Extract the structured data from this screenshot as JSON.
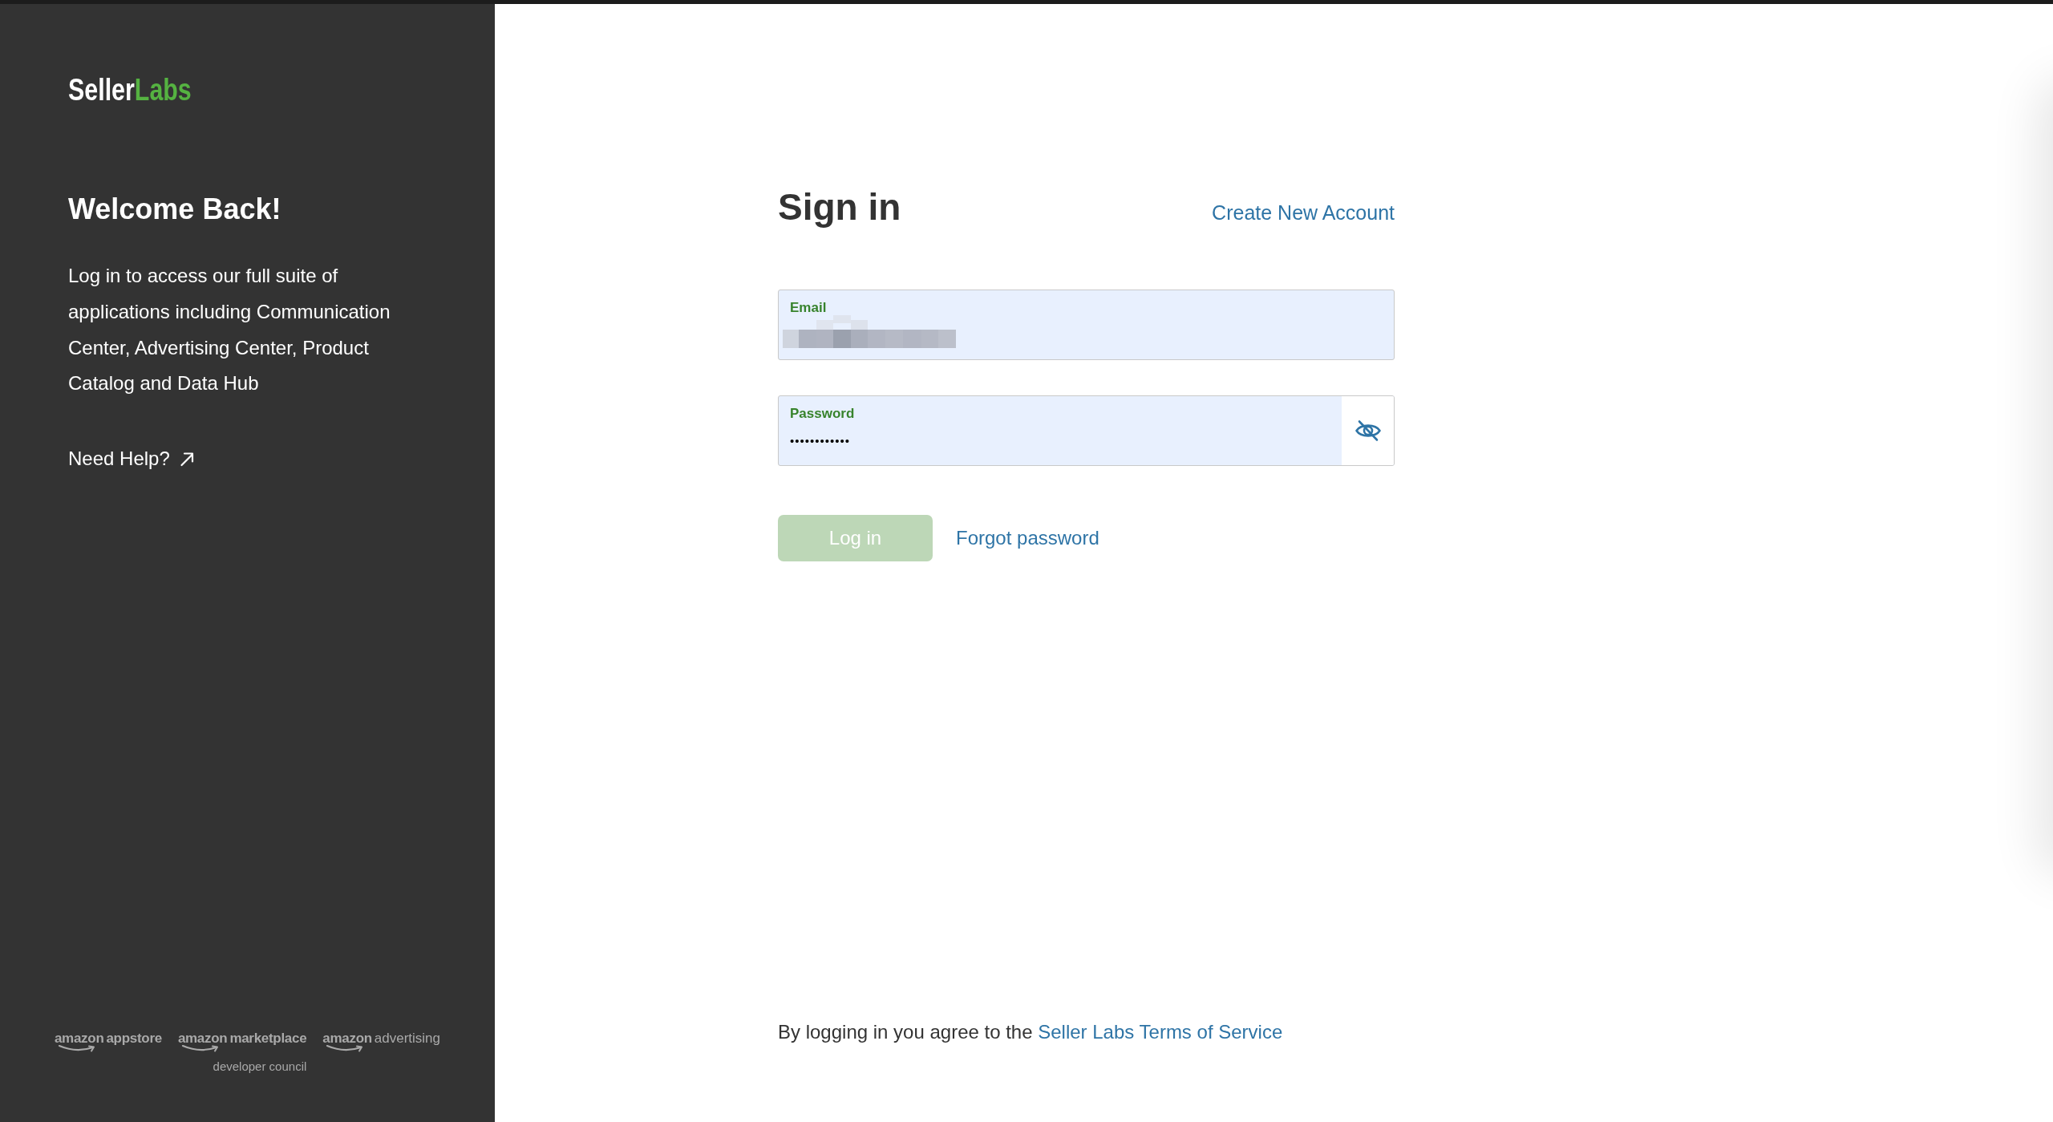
{
  "sidebar": {
    "logo": {
      "primary": "Seller",
      "accent": "Labs"
    },
    "heading": "Welcome Back!",
    "description": "Log in to access our full suite of applications including Communication Center, Advertising Center, Product Catalog and Data Hub",
    "help_link": "Need Help?",
    "partners": [
      {
        "brand": "amazon",
        "product": "appstore",
        "kind": "bold"
      },
      {
        "brand": "amazon",
        "product": "marketplace",
        "kind": "bold",
        "subtitle": "developer council"
      },
      {
        "brand": "amazon",
        "product": "advertising",
        "kind": "light"
      }
    ]
  },
  "form": {
    "title": "Sign in",
    "create_account_link": "Create New Account",
    "fields": [
      {
        "kind": "email",
        "label": "Email",
        "value_redacted": true,
        "autofilled": true
      },
      {
        "kind": "password",
        "label": "Password",
        "value": "••••••••••••",
        "autofilled": true,
        "revealed": false
      }
    ],
    "login_button": {
      "label": "Log in",
      "disabled": true
    },
    "forgot_password_link": "Forgot password",
    "terms": {
      "text": "By logging in you agree to the",
      "link": "Seller Labs Terms of Service"
    }
  }
}
